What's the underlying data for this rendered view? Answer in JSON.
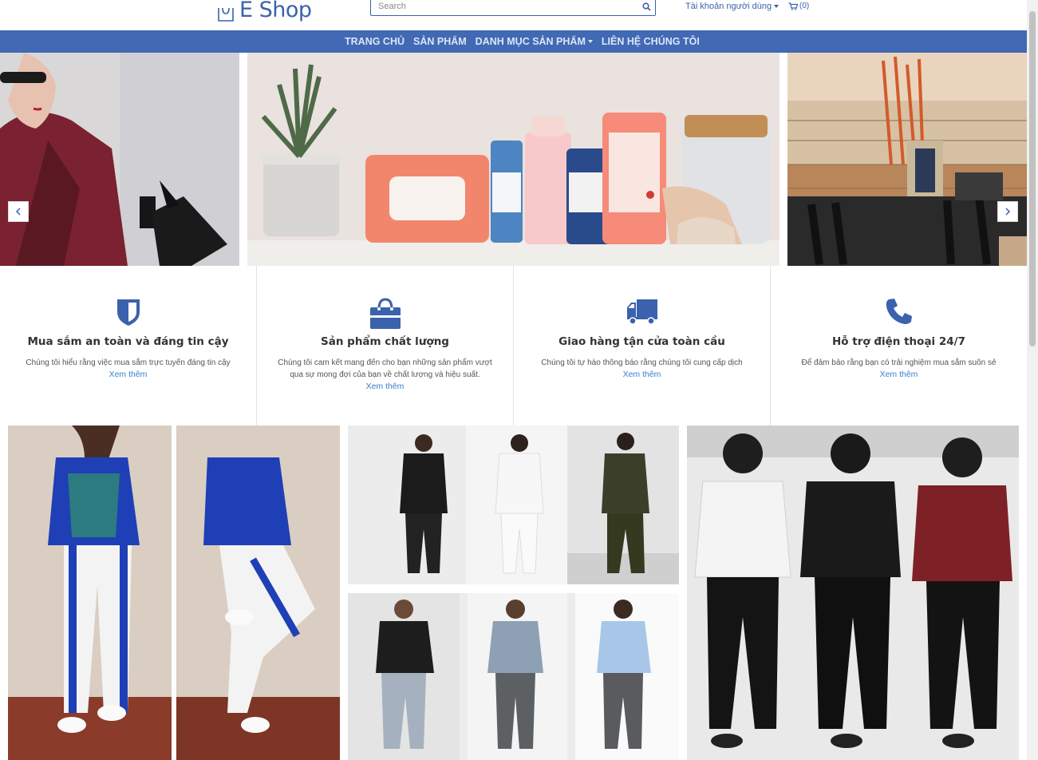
{
  "header": {
    "logo_text": "E Shop",
    "search_placeholder": "Search",
    "account_label": "Tài khoản người dùng",
    "cart_count": "(0)"
  },
  "nav": {
    "items": [
      {
        "label": "TRANG CHỦ"
      },
      {
        "label": "SẢN PHẨM"
      },
      {
        "label": "DANH MỤC SẢN PHẨM",
        "dropdown": true
      },
      {
        "label": "LIÊN HỆ CHÚNG TÔI"
      }
    ]
  },
  "features": [
    {
      "icon": "shield-icon",
      "title": "Mua sắm an toàn và đáng tin cậy",
      "desc": "Chúng tôi hiểu rằng việc mua sắm trực tuyến đáng tin cậy",
      "link": "Xem thêm"
    },
    {
      "icon": "shopping-bag-icon",
      "title": "Sản phẩm chất lượng",
      "desc": "Chúng tôi cam kết mang đến cho bạn những sản phẩm vượt qua sự mong đợi của bạn về chất lượng và hiệu suất.",
      "link": "Xem thêm"
    },
    {
      "icon": "truck-icon",
      "title": "Giao hàng tận cửa toàn cầu",
      "desc": "Chúng tôi tự hào thông báo rằng chúng tôi cung cấp dịch",
      "link": "Xem thêm"
    },
    {
      "icon": "phone-icon",
      "title": "Hỗ trợ điện thoại 24/7",
      "desc": "Để đảm bảo rằng bạn có trải nghiệm mua sắm suôn sẻ",
      "link": "Xem thêm"
    }
  ],
  "colors": {
    "brand_blue": "#4169b4",
    "link_blue": "#3a80d0",
    "icon_blue": "#3a62ad"
  }
}
